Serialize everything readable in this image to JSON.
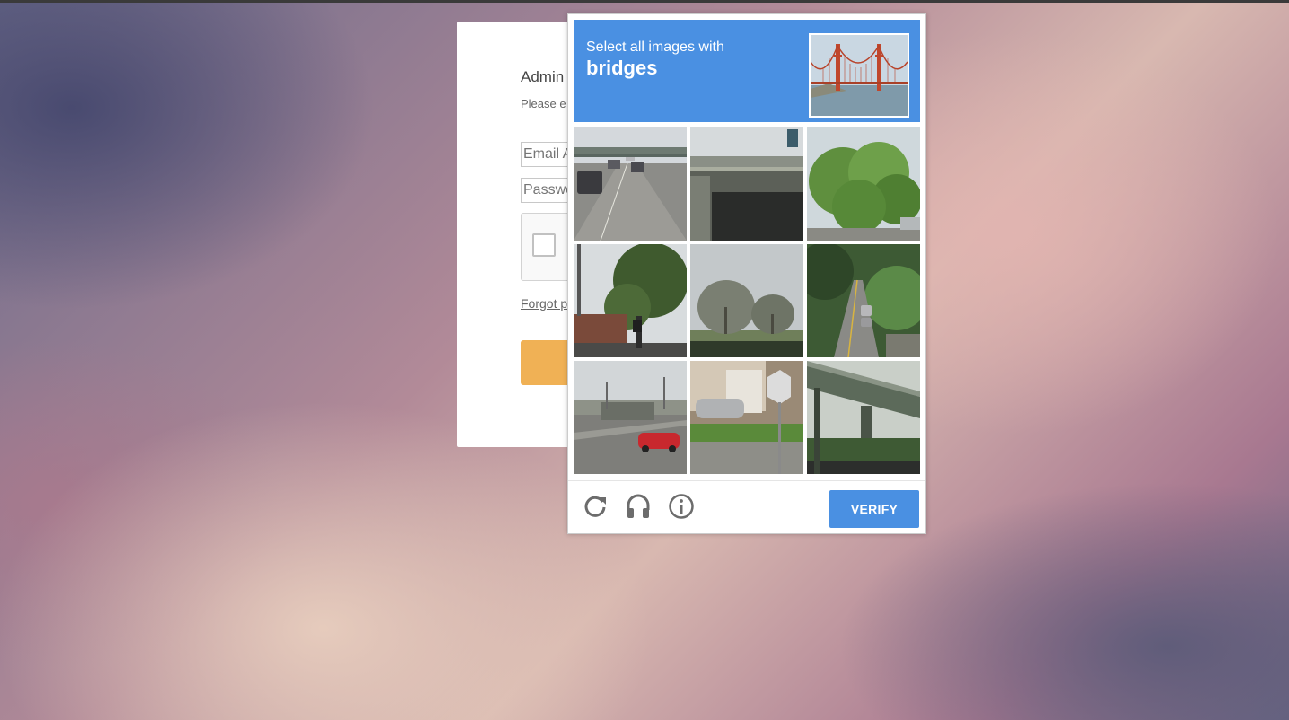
{
  "login": {
    "title": "Admin",
    "subtitle": "Please e",
    "email_placeholder": "Email A",
    "password_placeholder": "Passwo",
    "forgot_link": "Forgot p"
  },
  "captcha": {
    "instruction": "Select all images with",
    "keyword": "bridges",
    "sample_image": "golden-gate-bridge",
    "tiles": [
      "highway-traffic",
      "overpass-bridge",
      "green-tree",
      "street-corner-trees",
      "bare-trees-field",
      "residential-road",
      "highway-overpass-red-car",
      "house-stop-sign",
      "elevated-bridge"
    ],
    "footer_icons": [
      "reload-icon",
      "audio-icon",
      "info-icon"
    ],
    "verify_label": "VERIFY",
    "accent_color": "#4a90e2"
  }
}
